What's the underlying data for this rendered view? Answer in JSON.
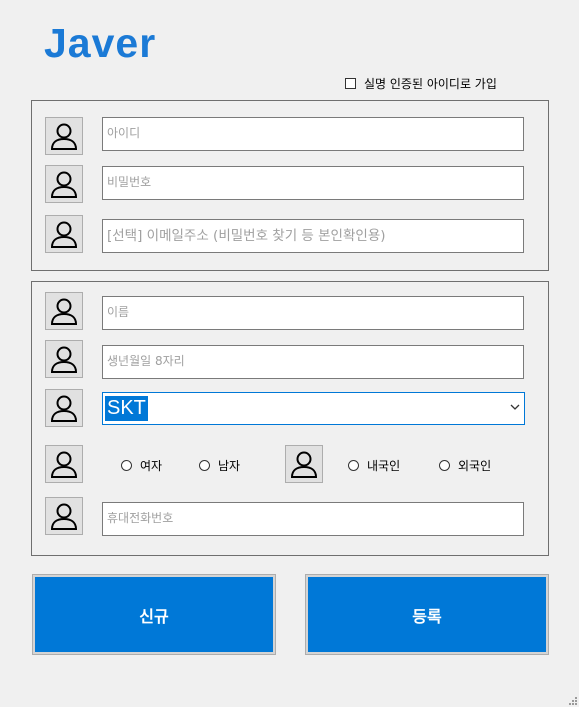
{
  "logo": "Javer",
  "realname_checkbox": {
    "label": "실명 인증된 아이디로 가입",
    "checked": false
  },
  "account": {
    "id_placeholder": "아이디",
    "password_placeholder": "비밀번호",
    "email_placeholder": "[선택] 이메일주소 (비밀번호 찾기 등 본인확인용)"
  },
  "profile": {
    "name_placeholder": "이름",
    "birth_placeholder": "생년월일 8자리",
    "carrier_selected": "SKT",
    "gender_options": [
      "여자",
      "남자"
    ],
    "nationality_options": [
      "내국인",
      "외국인"
    ],
    "phone_placeholder": "휴대전화번호"
  },
  "buttons": {
    "new_label": "신규",
    "register_label": "등록"
  },
  "colors": {
    "accent": "#0078d7",
    "logo": "#1b7ad6",
    "background": "#f0f0f0"
  },
  "icons": {
    "field_icon": "user-icon",
    "dropdown": "chevron-down-icon",
    "resize": "resize-grip-icon"
  }
}
